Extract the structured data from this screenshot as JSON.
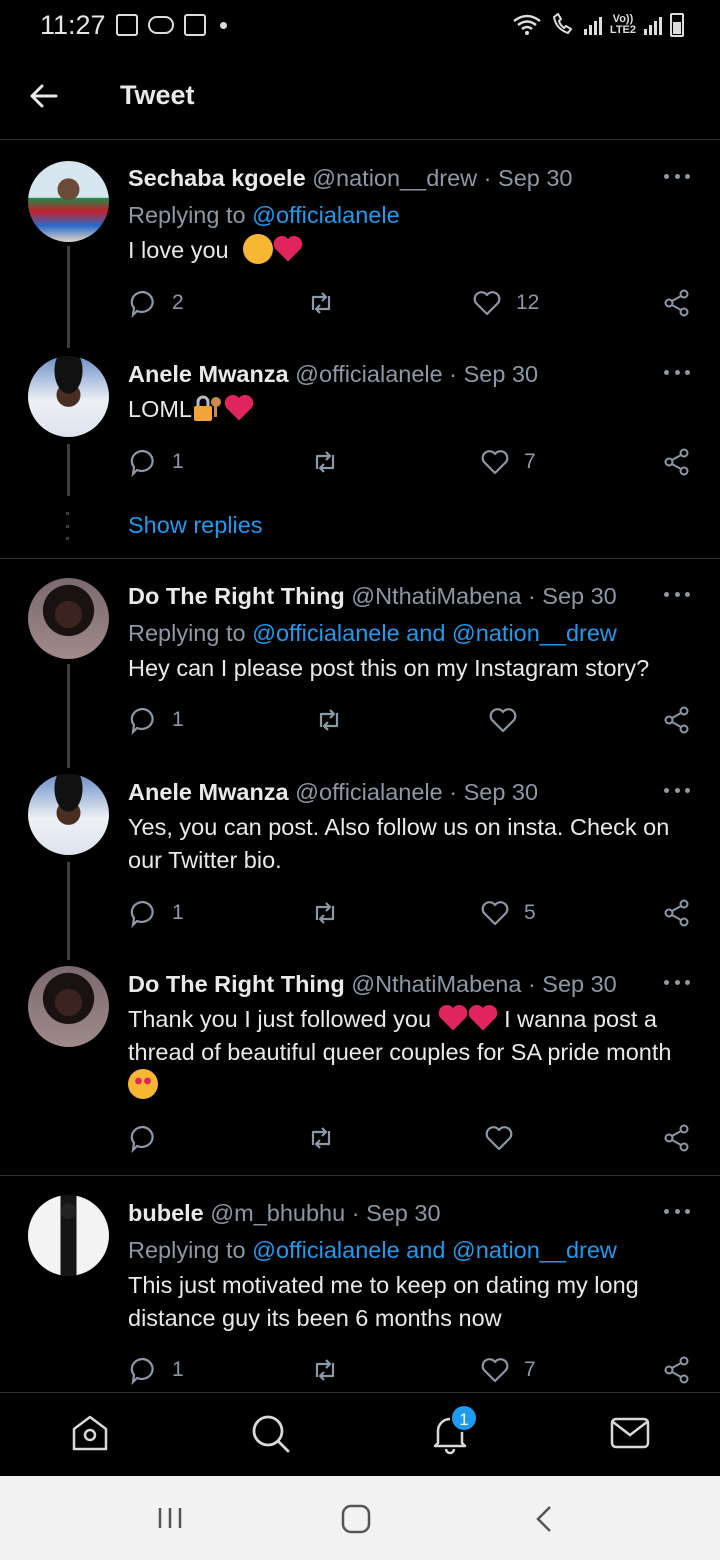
{
  "status_bar": {
    "time": "11:27",
    "lte_label_1": "Vo))",
    "lte_label_2": "LTE2"
  },
  "header": {
    "title": "Tweet"
  },
  "tweets": [
    {
      "name": "Sechaba kgoele",
      "handle": "@nation__drew · Sep 30",
      "reply_prefix": "Replying to ",
      "reply_to": "@officialanele",
      "text": "I love you",
      "replies": "2",
      "retweets": "",
      "likes": "12"
    },
    {
      "name": "Anele Mwanza",
      "handle": "@officialanele · Sep 30",
      "text": "LOML",
      "replies": "1",
      "retweets": "",
      "likes": "7"
    },
    {
      "name": "Do The Right Thing",
      "handle": "@NthatiMabena · Sep 30",
      "reply_prefix": "Replying to ",
      "reply_to": "@officialanele and @nation__drew",
      "text": "Hey can I please post this on my Instagram story?",
      "replies": "1",
      "retweets": "",
      "likes": ""
    },
    {
      "name": "Anele Mwanza",
      "handle": "@officialanele · Sep 30",
      "text": "Yes, you can post. Also follow us on insta. Check on our Twitter bio.",
      "replies": "1",
      "retweets": "",
      "likes": "5"
    },
    {
      "name": "Do The Right Thing",
      "handle": "@NthatiMabena · Sep 30",
      "text_part1": "Thank you I just followed you",
      "text_part2": " I wanna post a thread of beautiful queer couples for SA pride month",
      "replies": "",
      "retweets": "",
      "likes": ""
    },
    {
      "name": "bubele",
      "handle": "@m_bhubhu · Sep 30",
      "reply_prefix": "Replying to ",
      "reply_to": "@officialanele and @nation__drew",
      "text": "This just motivated me to keep on dating my long distance guy its been 6 months now",
      "replies": "1",
      "retweets": "",
      "likes": "7"
    }
  ],
  "show_replies": "Show replies",
  "bottom_nav": {
    "items": [
      "home-icon",
      "search-icon",
      "notifications-icon",
      "messages-icon"
    ],
    "notification_count": "1"
  },
  "colors": {
    "background": "#000000",
    "link": "#1d9bf0",
    "muted": "#8b98a5",
    "heart": "#e0245e"
  }
}
